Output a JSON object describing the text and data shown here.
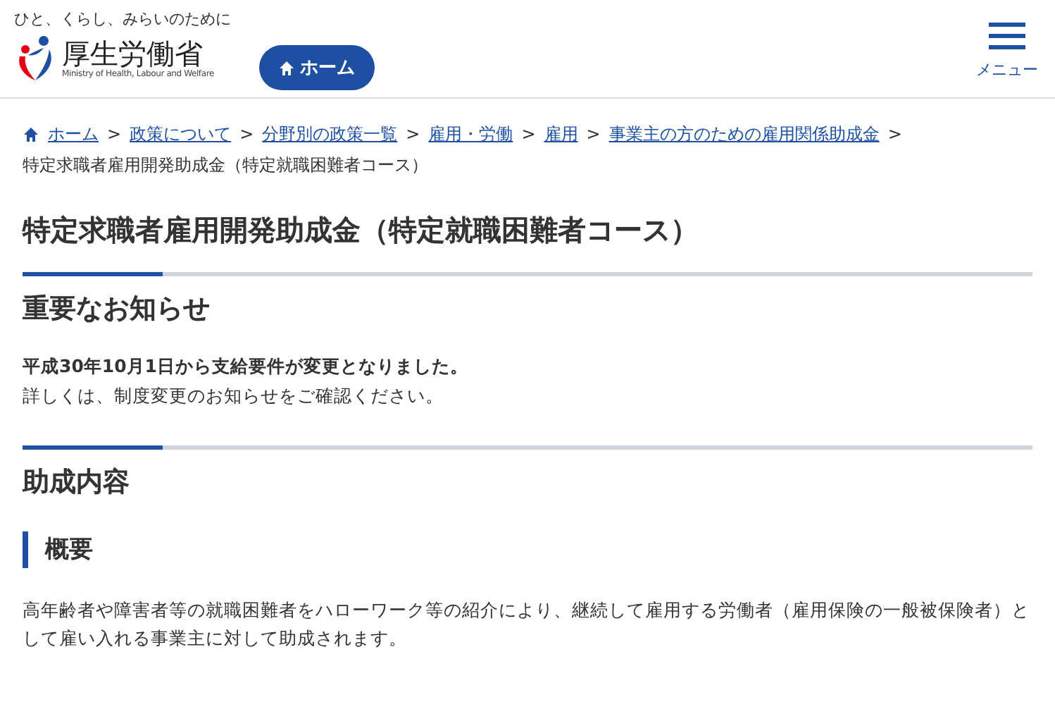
{
  "header": {
    "tagline": "ひと、くらし、みらいのために",
    "org_name": "厚生労働省",
    "org_name_en": "Ministry of Health, Labour and Welfare",
    "home_button": "ホーム",
    "menu_label": "メニュー"
  },
  "breadcrumb": {
    "links": [
      "ホーム",
      "政策について",
      "分野別の政策一覧",
      "雇用・労働",
      "雇用",
      "事業主の方のための雇用関係助成金"
    ],
    "separator": ">",
    "current": "特定求職者雇用開発助成金（特定就職困難者コース）"
  },
  "title": "特定求職者雇用開発助成金（特定就職困難者コース）",
  "sections": [
    {
      "heading": "重要なお知らせ",
      "blocks": [
        {
          "kind": "notice",
          "bold": "平成30年10月1日から支給要件が変更となりました。",
          "text": "詳しくは、制度変更のお知らせをご確認ください。"
        }
      ]
    },
    {
      "heading": "助成内容",
      "blocks": [
        {
          "kind": "subheading",
          "text": "概要"
        },
        {
          "kind": "paragraph",
          "text": "高年齢者や障害者等の就職困難者をハローワーク等の紹介により、継続して雇用する労働者（雇用保険の一般被保険者）として雇い入れる事業主に対して助成されます。"
        }
      ]
    }
  ]
}
